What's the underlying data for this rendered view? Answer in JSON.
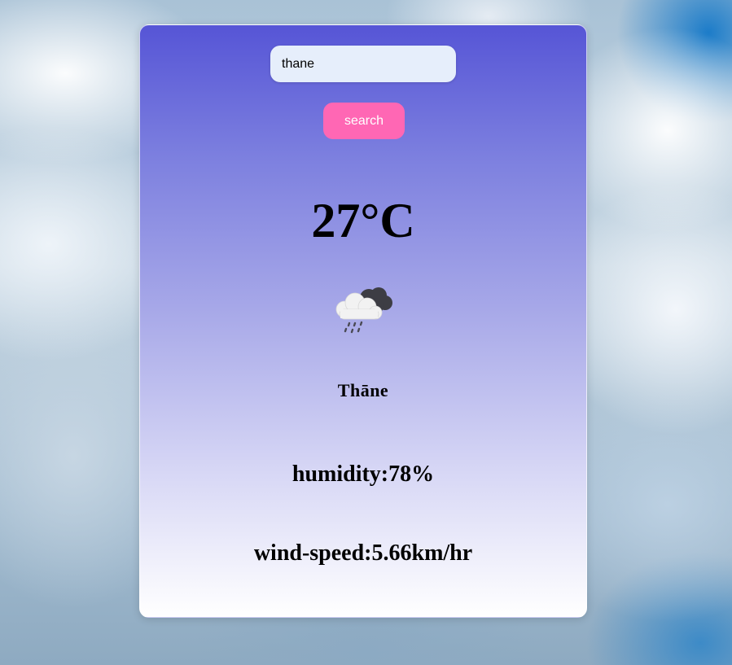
{
  "search": {
    "value": "thane",
    "button_label": "search"
  },
  "weather": {
    "temperature": "27°C",
    "icon": "rain-cloud-icon",
    "city": "Thāne",
    "humidity": "humidity:78%",
    "wind_speed": "wind-speed:5.66km/hr"
  },
  "colors": {
    "card_top": "#5655d6",
    "card_bottom": "#ffffff",
    "button": "#ff67b4",
    "input_bg": "#e6eefb"
  }
}
